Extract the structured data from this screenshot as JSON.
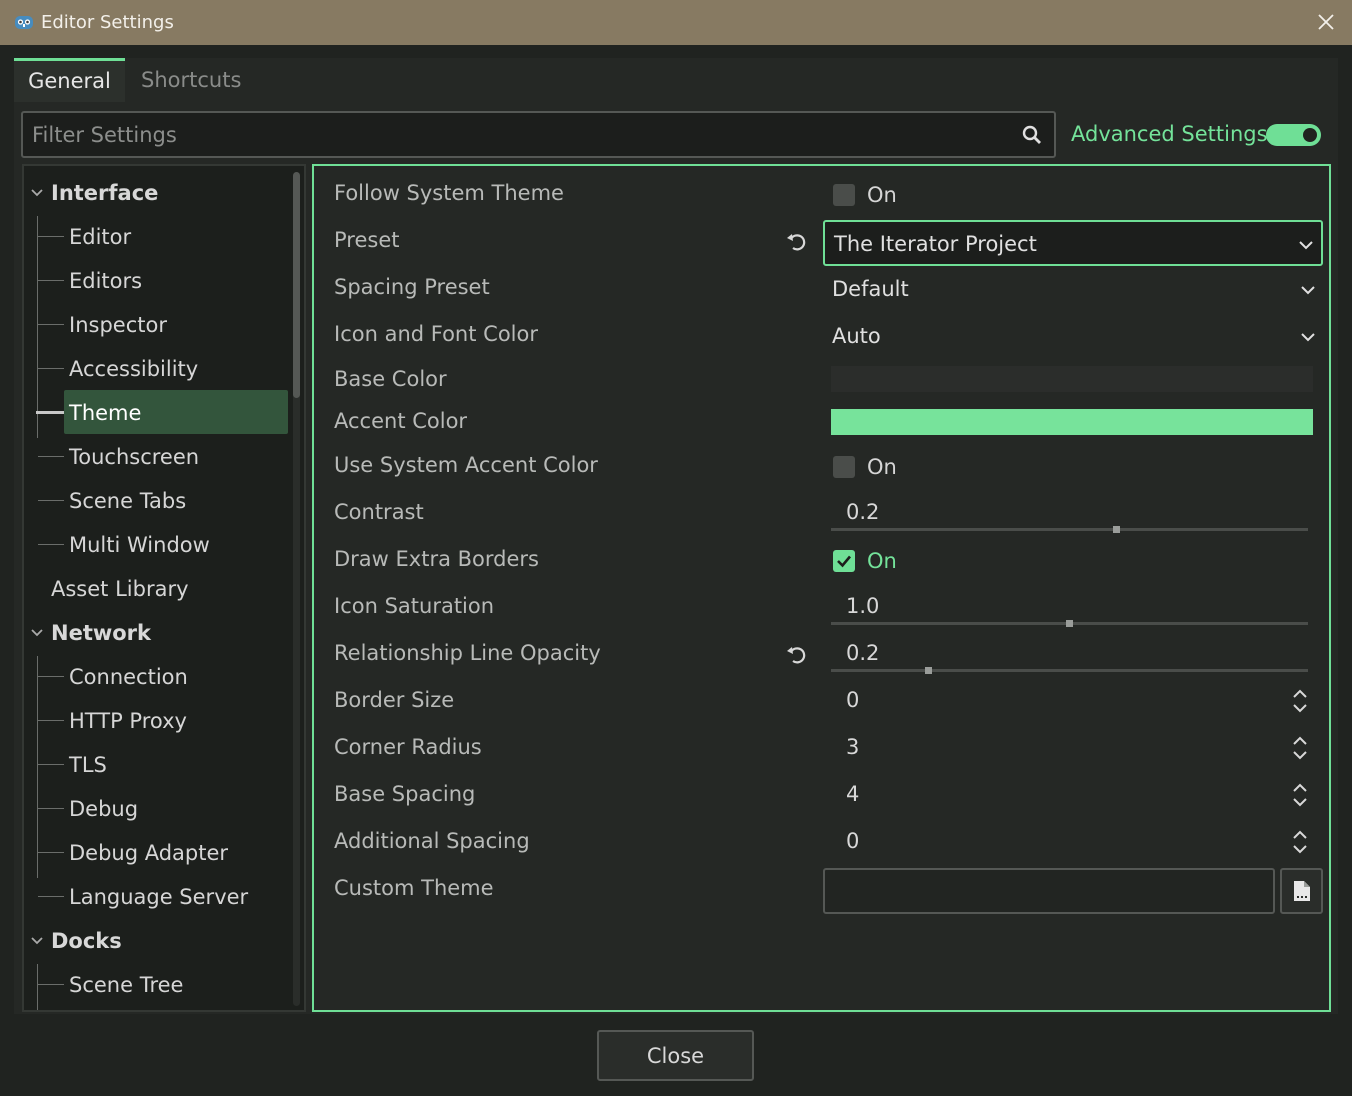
{
  "window": {
    "title": "Editor Settings",
    "app_icon": "godot-icon",
    "close_icon": "close-icon"
  },
  "tabs": [
    {
      "label": "General",
      "active": true
    },
    {
      "label": "Shortcuts",
      "active": false
    }
  ],
  "filter": {
    "placeholder": "Filter Settings",
    "icon": "search-icon"
  },
  "advanced": {
    "label": "Advanced Settings",
    "enabled": true
  },
  "tree": {
    "sections": [
      {
        "label": "Interface",
        "expanded": true,
        "items": [
          "Editor",
          "Editors",
          "Inspector",
          "Accessibility",
          "Theme",
          "Touchscreen",
          "Scene Tabs",
          "Multi Window"
        ]
      },
      {
        "label": "Asset Library",
        "expanded": false,
        "items": []
      },
      {
        "label": "Network",
        "expanded": true,
        "items": [
          "Connection",
          "HTTP Proxy",
          "TLS",
          "Debug",
          "Debug Adapter",
          "Language Server"
        ]
      },
      {
        "label": "Docks",
        "expanded": true,
        "items": [
          "Scene Tree"
        ]
      }
    ],
    "selected": "Theme"
  },
  "properties": {
    "follow_system_theme": {
      "label": "Follow System Theme",
      "value": "On",
      "checked": false
    },
    "preset": {
      "label": "Preset",
      "value": "The Iterator Project"
    },
    "spacing_preset": {
      "label": "Spacing Preset",
      "value": "Default"
    },
    "icon_font_color": {
      "label": "Icon and Font Color",
      "value": "Auto"
    },
    "base_color": {
      "label": "Base Color",
      "color": "#2b2d2b"
    },
    "accent_color": {
      "label": "Accent Color",
      "color": "#77e39b"
    },
    "use_system_accent": {
      "label": "Use System Accent Color",
      "value": "On",
      "checked": false
    },
    "contrast": {
      "label": "Contrast",
      "value": "0.2",
      "fraction": 0.6
    },
    "draw_extra_borders": {
      "label": "Draw Extra Borders",
      "value": "On",
      "checked": true
    },
    "icon_saturation": {
      "label": "Icon Saturation",
      "value": "1.0",
      "fraction": 0.5
    },
    "relationship_line_opacity": {
      "label": "Relationship Line Opacity",
      "value": "0.2",
      "fraction": 0.2
    },
    "border_size": {
      "label": "Border Size",
      "value": "0"
    },
    "corner_radius": {
      "label": "Corner Radius",
      "value": "3"
    },
    "base_spacing": {
      "label": "Base Spacing",
      "value": "4"
    },
    "additional_spacing": {
      "label": "Additional Spacing",
      "value": "0"
    },
    "custom_theme": {
      "label": "Custom Theme",
      "value": ""
    }
  },
  "footer": {
    "close_label": "Close"
  },
  "colors": {
    "accent": "#6fdf96",
    "titlebar": "#877a62",
    "selected_bg": "#33553c"
  }
}
